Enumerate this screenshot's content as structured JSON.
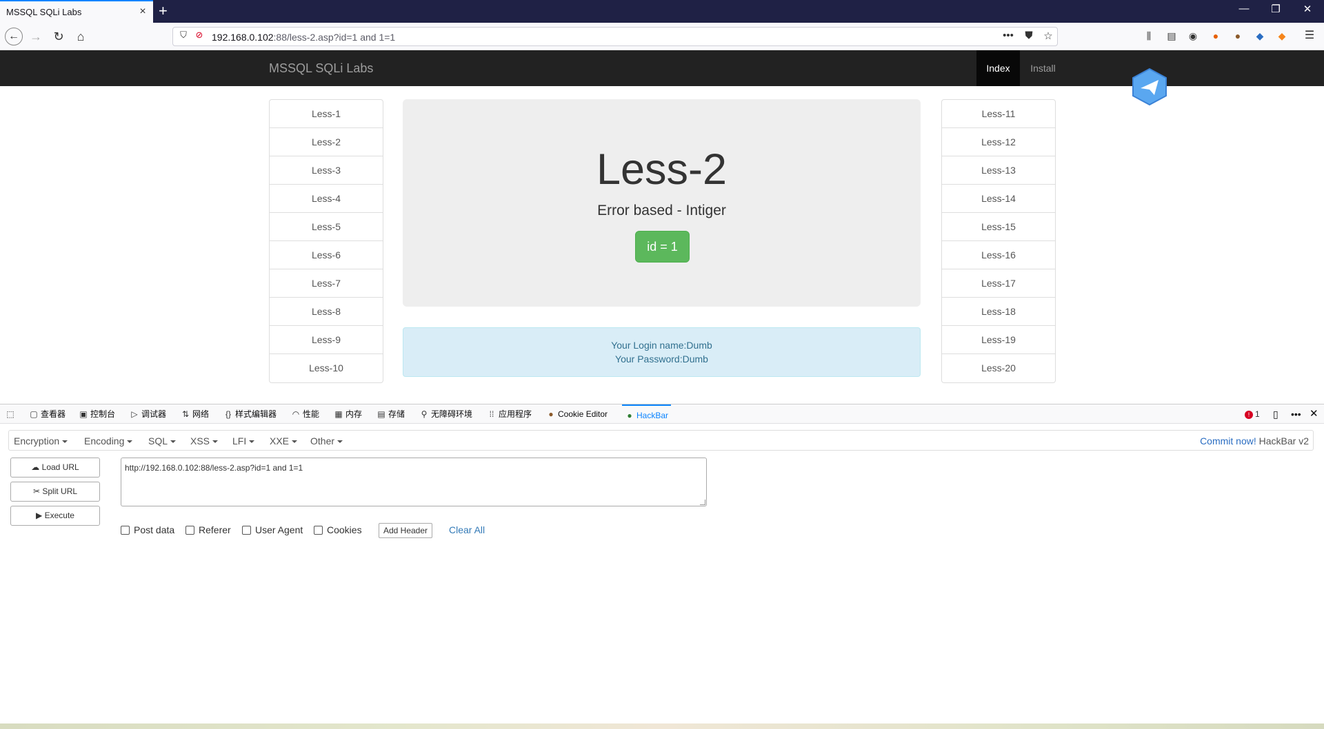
{
  "browser": {
    "tab_title": "MSSQL SQLi Labs",
    "tab_close_icon": "×",
    "new_tab_icon": "+",
    "url_host": "192.168.0.102",
    "url_rest": ":88/less-2.asp?id=1 and 1=1"
  },
  "site": {
    "brand": "MSSQL SQLi Labs",
    "nav": {
      "index": "Index",
      "install": "Install"
    },
    "lessons_left": [
      "Less-1",
      "Less-2",
      "Less-3",
      "Less-4",
      "Less-5",
      "Less-6",
      "Less-7",
      "Less-8",
      "Less-9",
      "Less-10"
    ],
    "lessons_right": [
      "Less-11",
      "Less-12",
      "Less-13",
      "Less-14",
      "Less-15",
      "Less-16",
      "Less-17",
      "Less-18",
      "Less-19",
      "Less-20"
    ],
    "jumbotron": {
      "title": "Less-2",
      "subtitle": "Error based - Intiger",
      "button": "id = 1"
    },
    "info": {
      "line1": "Your Login name:Dumb",
      "line2": "Your Password:Dumb"
    }
  },
  "devtools": {
    "tabs": {
      "inspector": "查看器",
      "console": "控制台",
      "debugger": "调试器",
      "network": "网络",
      "style_editor": "样式编辑器",
      "performance": "性能",
      "memory": "内存",
      "storage": "存储",
      "accessibility": "无障碍环境",
      "application": "应用程序",
      "cookie_editor": "Cookie Editor",
      "hackbar": "HackBar"
    },
    "error_count": "1",
    "error_icon": "!"
  },
  "hackbar": {
    "menu": [
      "Encryption",
      "Encoding",
      "SQL",
      "XSS",
      "LFI",
      "XXE",
      "Other"
    ],
    "commit_link": "Commit now!",
    "version": "HackBar v2",
    "buttons": {
      "load": "Load URL",
      "split": "Split URL",
      "execute": "Execute"
    },
    "url_value": "http://192.168.0.102:88/less-2.asp?id=1 and 1=1",
    "checks": {
      "post": "Post data",
      "referer": "Referer",
      "ua": "User Agent",
      "cookies": "Cookies"
    },
    "add_header": "Add Header",
    "clear_all": "Clear All"
  },
  "colors": {
    "accent": "#0a84ff",
    "success": "#5cb85c",
    "info_bg": "#d9edf7",
    "navbar_bg": "#222222"
  }
}
